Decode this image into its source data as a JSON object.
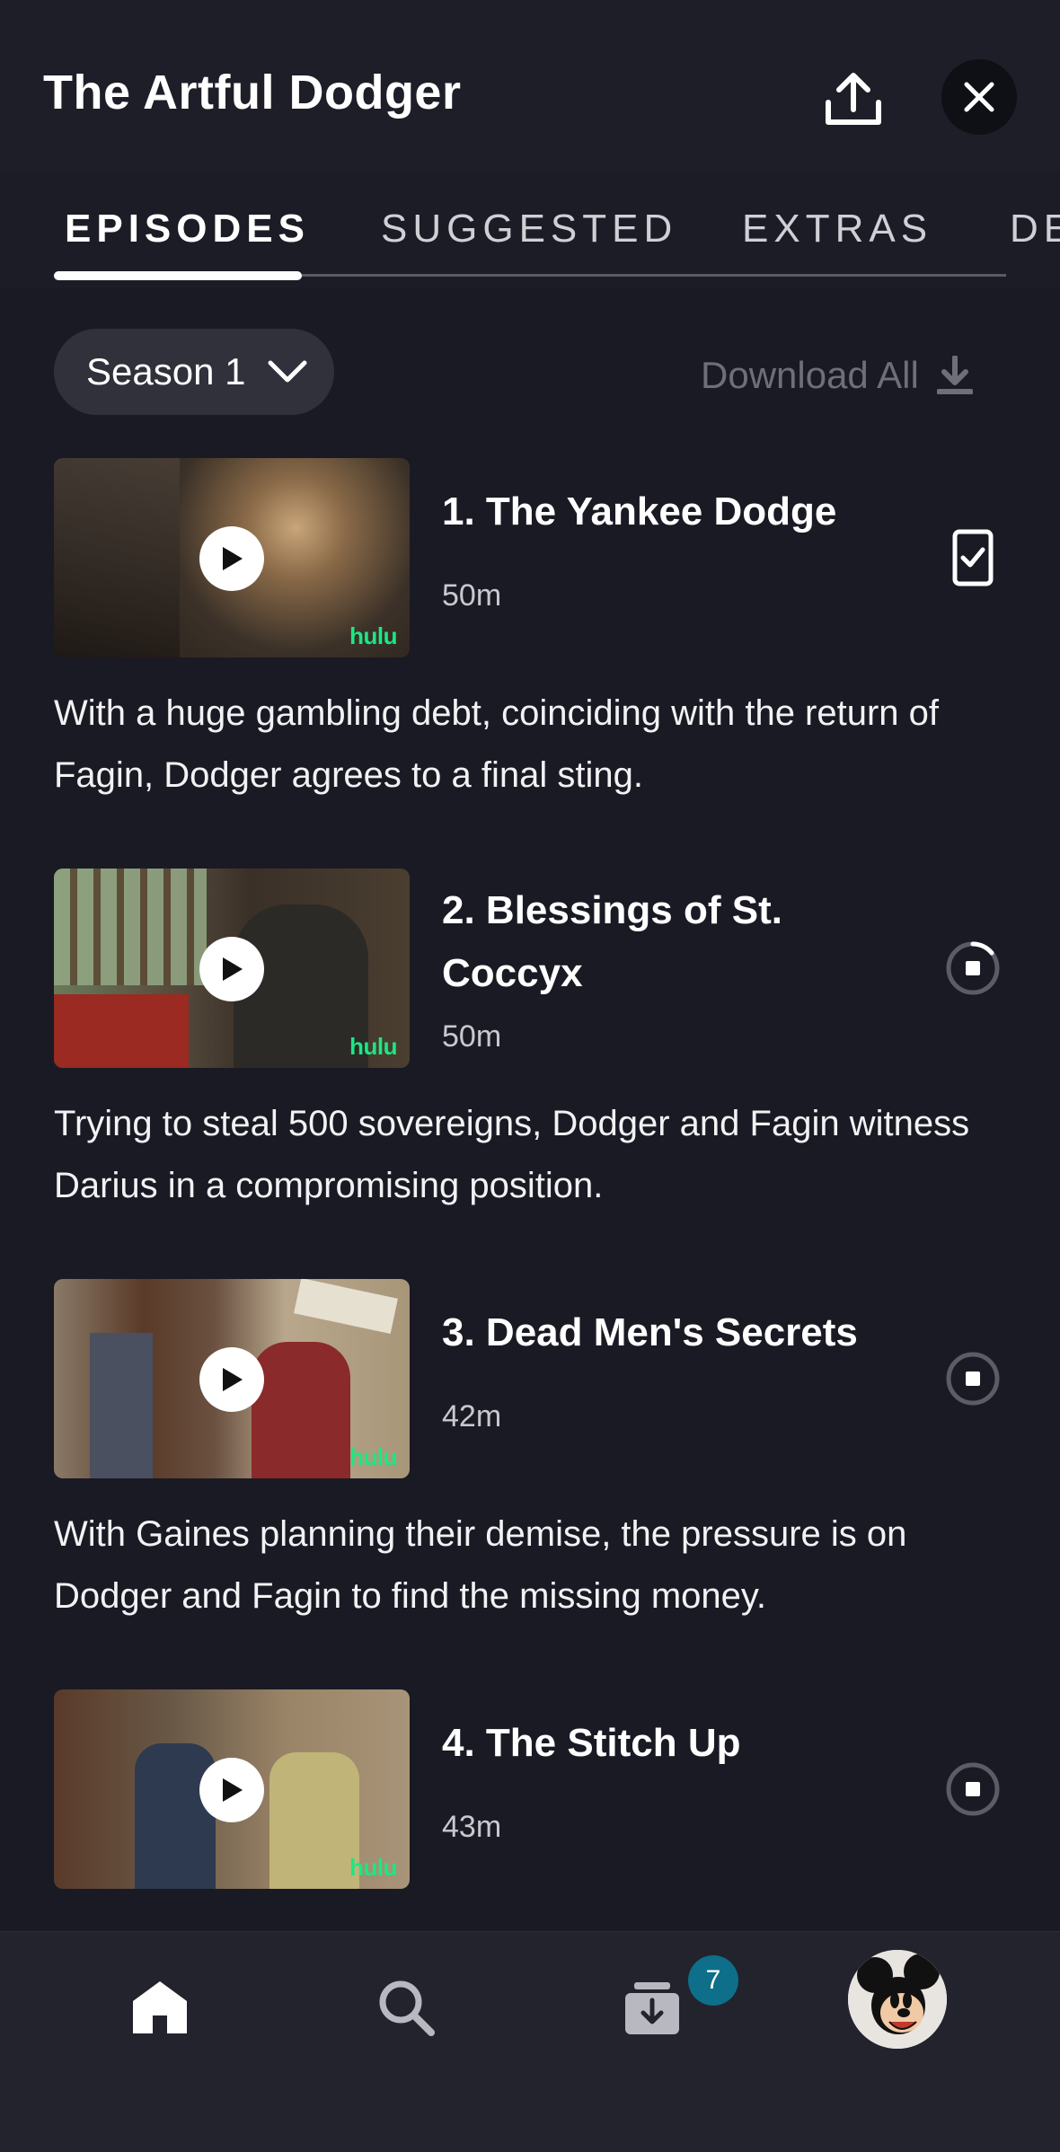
{
  "header": {
    "title": "The Artful Dodger",
    "share_icon": "share-upload-icon",
    "close_icon": "close-icon"
  },
  "tabs": [
    {
      "label": "EPISODES",
      "active": true
    },
    {
      "label": "SUGGESTED",
      "active": false
    },
    {
      "label": "EXTRAS",
      "active": false
    },
    {
      "label": "DE",
      "active": false
    }
  ],
  "season_selector": {
    "label": "Season 1"
  },
  "download_all": {
    "label": "Download All"
  },
  "episodes": [
    {
      "title": "1. The Yankee Dodge",
      "duration": "50m",
      "description": "With a huge gambling debt, coinciding with the return of Fagin, Dodger agrees to a final sting.",
      "badge": "hulu",
      "status": "downloaded"
    },
    {
      "title": "2. Blessings of St. Coccyx",
      "duration": "50m",
      "description": "Trying to steal 500 sovereigns, Dodger and Fagin witness Darius in a compromising position.",
      "badge": "hulu",
      "status": "downloading"
    },
    {
      "title": "3. Dead Men's Secrets",
      "duration": "42m",
      "description": "With Gaines planning their demise, the pressure is on Dodger and Fagin to find the missing money.",
      "badge": "hulu",
      "status": "queued"
    },
    {
      "title": "4. The Stitch Up",
      "duration": "43m",
      "description": "",
      "badge": "hulu",
      "status": "queued"
    }
  ],
  "bottom_nav": {
    "downloads_badge": "7"
  },
  "colors": {
    "background": "#1a1a24",
    "hulu_green": "#1ce783",
    "badge": "#0d6f8a"
  }
}
